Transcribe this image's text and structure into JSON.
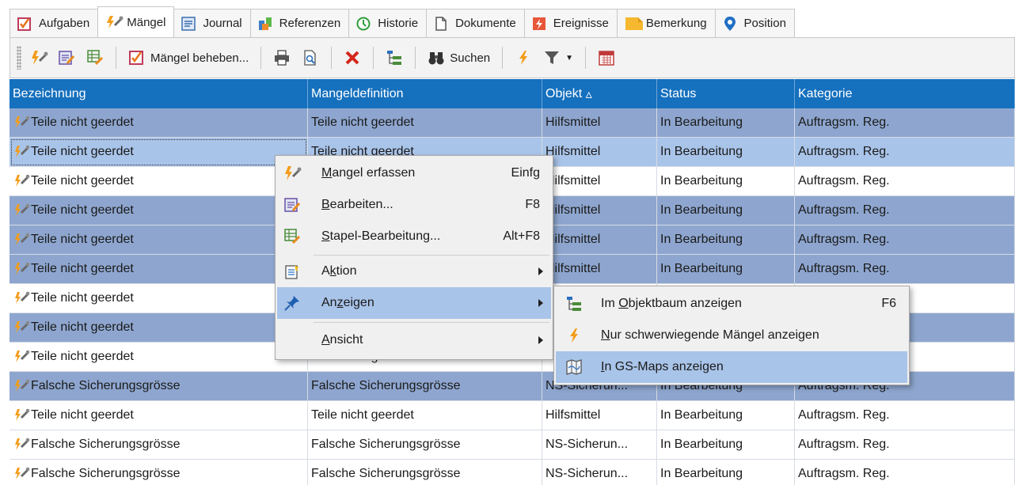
{
  "tabs": [
    {
      "label": "Aufgaben",
      "icon": "checkbox-icon"
    },
    {
      "label": "Mängel",
      "icon": "defect-icon"
    },
    {
      "label": "Journal",
      "icon": "journal-icon"
    },
    {
      "label": "Referenzen",
      "icon": "references-icon"
    },
    {
      "label": "Historie",
      "icon": "history-icon"
    },
    {
      "label": "Dokumente",
      "icon": "document-icon"
    },
    {
      "label": "Ereignisse",
      "icon": "event-icon"
    },
    {
      "label": "Bemerkung",
      "icon": "note-icon"
    },
    {
      "label": "Position",
      "icon": "location-pin-icon"
    }
  ],
  "active_tab": "Mängel",
  "toolbar": {
    "fix_label": "Mängel beheben...",
    "search_label": "Suchen"
  },
  "grid": {
    "columns": [
      "Bezeichnung",
      "Mangeldefinition",
      "Objekt",
      "Status",
      "Kategorie"
    ],
    "sort_indicator": "▵",
    "rows": [
      {
        "bez": "Teile nicht geerdet",
        "def": "Teile nicht geerdet",
        "obj": "Hilfsmittel",
        "status": "In Bearbeitung",
        "kat": "Auftragsm. Reg."
      },
      {
        "bez": "Teile nicht geerdet",
        "def": "Teile nicht geerdet",
        "obj": "Hilfsmittel",
        "status": "In Bearbeitung",
        "kat": "Auftragsm. Reg."
      },
      {
        "bez": "Teile nicht geerdet",
        "def": "",
        "obj": "Hilfsmittel",
        "status": "In Bearbeitung",
        "kat": "Auftragsm. Reg."
      },
      {
        "bez": "Teile nicht geerdet",
        "def": "",
        "obj": "Hilfsmittel",
        "status": "In Bearbeitung",
        "kat": "Auftragsm. Reg."
      },
      {
        "bez": "Teile nicht geerdet",
        "def": "",
        "obj": "Hilfsmittel",
        "status": "In Bearbeitung",
        "kat": "Auftragsm. Reg."
      },
      {
        "bez": "Teile nicht geerdet",
        "def": "",
        "obj": "Hilfsmittel",
        "status": "In Bearbeitung",
        "kat": "Auftragsm. Reg."
      },
      {
        "bez": "Teile nicht geerdet",
        "def": "",
        "obj": "",
        "status": "",
        "kat": ""
      },
      {
        "bez": "Teile nicht geerdet",
        "def": "",
        "obj": "",
        "status": "",
        "kat": ""
      },
      {
        "bez": "Teile nicht geerdet",
        "def": "Teile nicht geerdet",
        "obj": "",
        "status": "",
        "kat": ""
      },
      {
        "bez": "Falsche Sicherungsgrösse",
        "def": "Falsche Sicherungsgrösse",
        "obj": "NS-Sicherun...",
        "status": "In Bearbeitung",
        "kat": "Auftragsm. Reg."
      },
      {
        "bez": "Teile nicht geerdet",
        "def": "Teile nicht geerdet",
        "obj": "Hilfsmittel",
        "status": "In Bearbeitung",
        "kat": "Auftragsm. Reg."
      },
      {
        "bez": "Falsche Sicherungsgrösse",
        "def": "Falsche Sicherungsgrösse",
        "obj": "NS-Sicherun...",
        "status": "In Bearbeitung",
        "kat": "Auftragsm. Reg."
      },
      {
        "bez": "Falsche Sicherungsgrösse",
        "def": "Falsche Sicherungsgrösse",
        "obj": "NS-Sicherun...",
        "status": "In Bearbeitung",
        "kat": "Auftragsm. Reg."
      }
    ]
  },
  "context_menu": {
    "items": [
      {
        "pre": "",
        "ul": "M",
        "post": "angel erfassen",
        "key": "Einfg"
      },
      {
        "pre": "",
        "ul": "B",
        "post": "earbeiten...",
        "key": "F8"
      },
      {
        "pre": "",
        "ul": "S",
        "post": "tapel-Bearbeitung...",
        "key": "Alt+F8"
      },
      {
        "pre": "A",
        "ul": "k",
        "post": "tion",
        "key": ""
      },
      {
        "pre": "An",
        "ul": "z",
        "post": "eigen",
        "key": ""
      },
      {
        "pre": "",
        "ul": "A",
        "post": "nsicht",
        "key": ""
      }
    ]
  },
  "submenu": {
    "items": [
      {
        "pre": "Im ",
        "ul": "O",
        "post": "bjektbaum anzeigen",
        "key": "F6"
      },
      {
        "pre": "",
        "ul": "N",
        "post": "ur schwerwiegende Mängel anzeigen",
        "key": ""
      },
      {
        "pre": "",
        "ul": "I",
        "post": "n GS-Maps anzeigen",
        "key": ""
      }
    ]
  },
  "colors": {
    "header": "#1570be",
    "row_shade": "#8ea6cf",
    "row_selected": "#a9c4e9",
    "menu_bg": "#f0f0f0"
  }
}
